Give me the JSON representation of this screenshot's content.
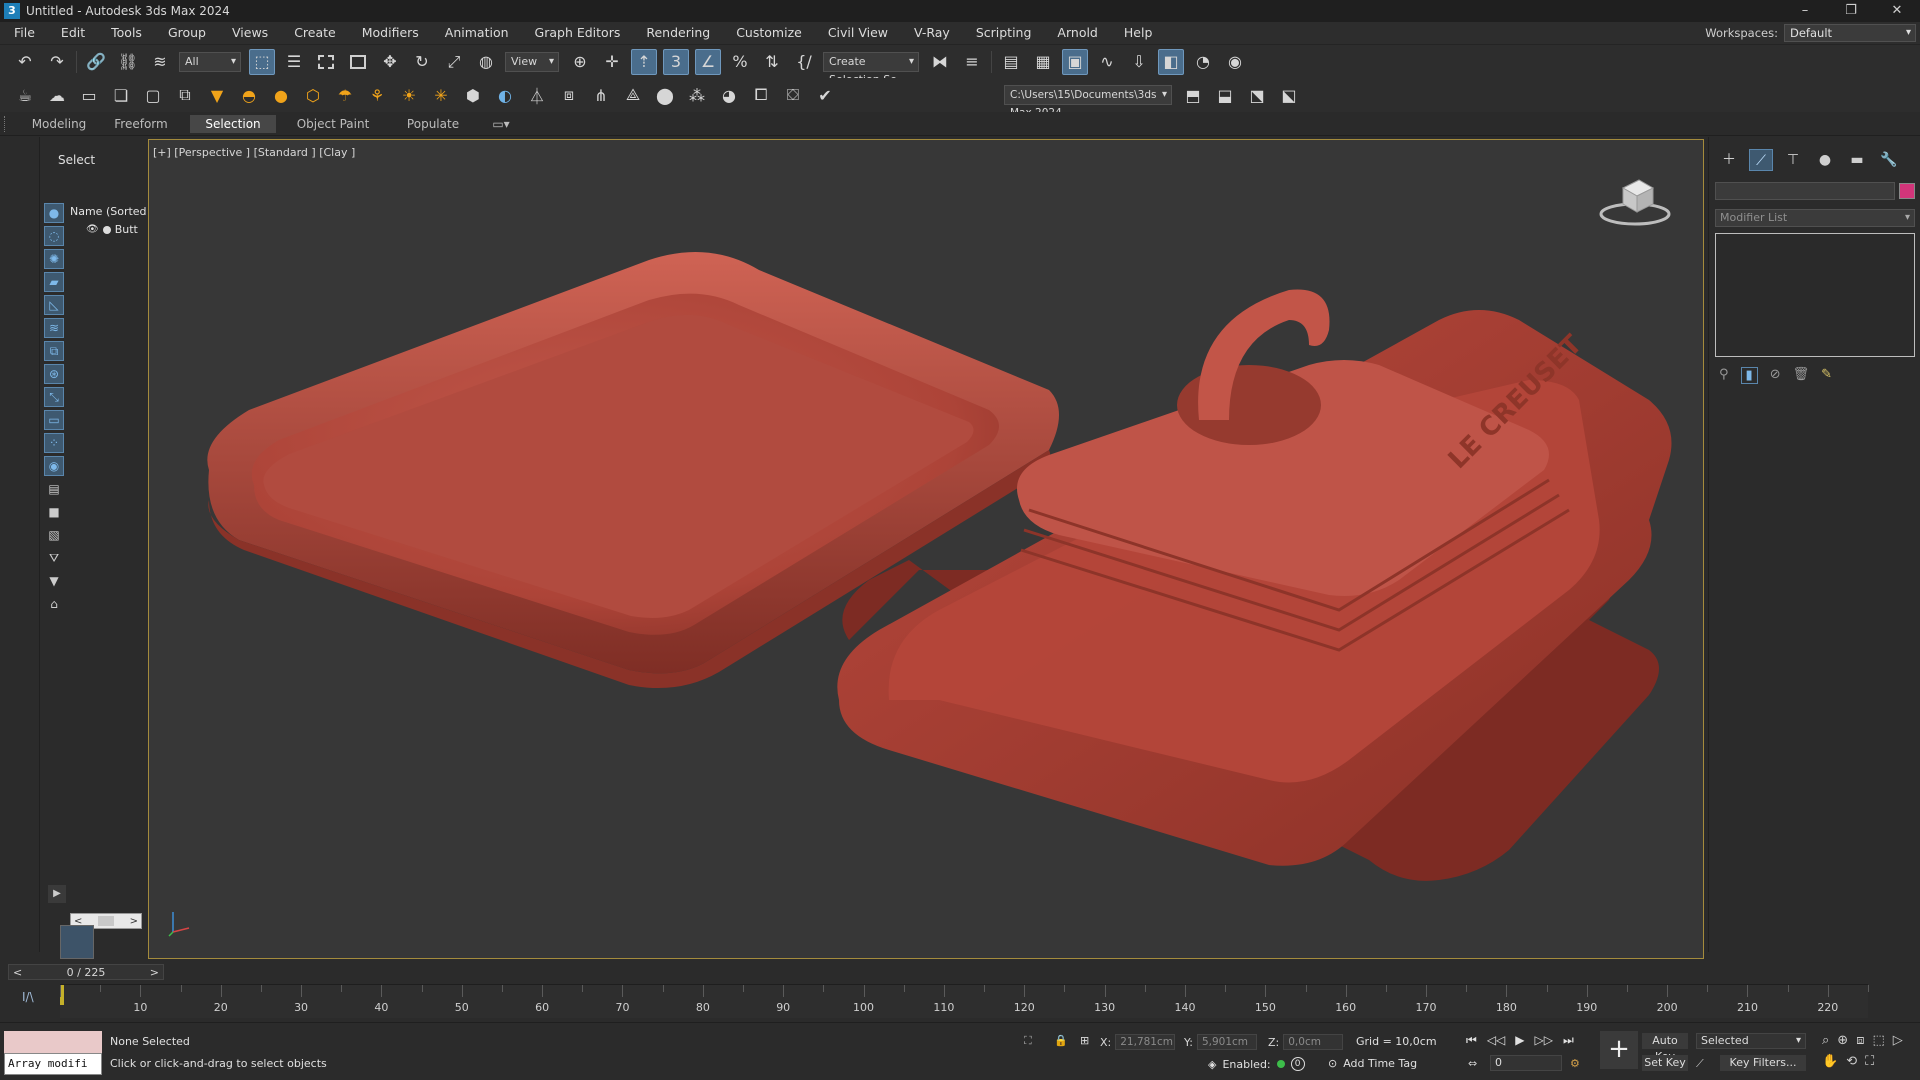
{
  "window": {
    "title": "Untitled - Autodesk 3ds Max 2024",
    "logo": "3",
    "controls": [
      "–",
      "❐",
      "✕"
    ]
  },
  "menu": {
    "items": [
      "File",
      "Edit",
      "Tools",
      "Group",
      "Views",
      "Create",
      "Modifiers",
      "Animation",
      "Graph Editors",
      "Rendering",
      "Customize",
      "Civil View",
      "V-Ray",
      "Scripting",
      "Arnold",
      "Help"
    ],
    "workspace_label": "Workspaces:",
    "workspace_value": "Default"
  },
  "toolbar": {
    "filter_value": "All",
    "refcoord_value": "View",
    "named_selection": "Create Selection Se",
    "project_path": "C:\\Users\\15\\Documents\\3ds Max 2024"
  },
  "ribbon": {
    "tabs": [
      "Modeling",
      "Freeform",
      "Selection",
      "Object Paint",
      "Populate"
    ],
    "active_tab": "Selection"
  },
  "explorer": {
    "header": "Select",
    "column": "Name (Sorted A",
    "row_label": "Butt",
    "scroll_left": "<",
    "scroll_right": ">"
  },
  "viewport": {
    "label": "[+] [Perspective ] [Standard ] [Clay ]",
    "emboss_text": "LE CREUSET",
    "object_color": "#b24a3e"
  },
  "command_panel": {
    "modifier_list": "Modifier List",
    "color_swatch": "#d2357a"
  },
  "timeline": {
    "slider": "0 / 225",
    "prev": "<",
    "next": ">",
    "labels": [
      "10",
      "20",
      "30",
      "40",
      "50",
      "60",
      "70",
      "80",
      "90",
      "100",
      "110",
      "120",
      "130",
      "140",
      "150",
      "160",
      "170",
      "180",
      "190",
      "200",
      "210",
      "220"
    ]
  },
  "status": {
    "maxscript_value": "Array modifi",
    "line1": "None Selected",
    "line2": "Click or click-and-drag to select objects",
    "x_label": "X:",
    "x_value": "21,781cm",
    "y_label": "Y:",
    "y_value": "5,901cm",
    "z_label": "Z:",
    "z_value": "0,0cm",
    "grid": "Grid = 10,0cm",
    "enabled_label": "Enabled:",
    "enabled_value": "0",
    "add_time_tag": "Add Time Tag",
    "frame_value": "0",
    "auto_key": "Auto Key",
    "set_key": "Set Key",
    "selected": "Selected",
    "key_filters": "Key Filters..."
  }
}
